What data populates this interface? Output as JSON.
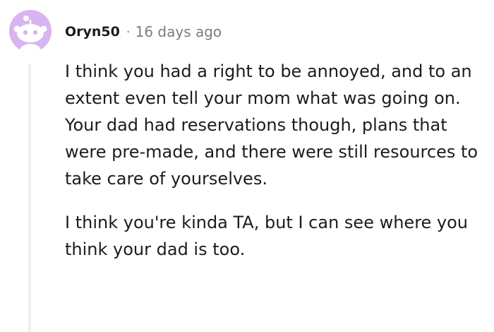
{
  "comment": {
    "author": "Oryn50",
    "separator": "·",
    "timestamp": "16 days ago",
    "avatar_icon": "reddit-snoo-icon",
    "avatar_bg": "#d8b4f0",
    "paragraphs": [
      "I think you had a right to be annoyed, and to an extent even tell your mom what was going on. Your dad had reservations though, plans that were pre-made, and there were still resources to take care of yourselves.",
      "I think you're kinda TA, but I can see where you think your dad is too."
    ]
  }
}
